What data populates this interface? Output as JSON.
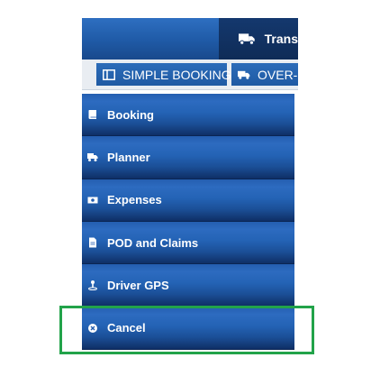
{
  "header": {
    "tab_label": "Trans",
    "tab_icon": "truck-icon"
  },
  "toolbar": {
    "simple_booking_label": "SIMPLE BOOKING",
    "simple_booking_icon": "columns-icon",
    "over_label": "OVER-S",
    "over_icon": "truck-icon"
  },
  "sidebar": {
    "items": [
      {
        "label": "Booking",
        "icon": "book-icon"
      },
      {
        "label": "Planner",
        "icon": "truck-icon"
      },
      {
        "label": "Expenses",
        "icon": "money-icon"
      },
      {
        "label": "POD and Claims",
        "icon": "file-icon"
      },
      {
        "label": "Driver GPS",
        "icon": "map-pin-icon"
      },
      {
        "label": "Cancel",
        "icon": "cancel-circle-icon"
      }
    ]
  },
  "colors": {
    "menu_blue": "#245eb0",
    "highlight_green": "#22a34a"
  }
}
